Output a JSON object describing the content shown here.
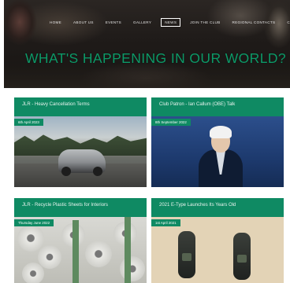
{
  "hero": {
    "title": "WHAT'S HAPPENING IN OUR WORLD?",
    "nav": [
      "HOME",
      "ABOUT US",
      "EVENTS",
      "GALLERY",
      "NEWS",
      "JOIN THE CLUB",
      "REGIONAL CONTACTS",
      "C"
    ],
    "active_nav": "NEWS"
  },
  "cards": [
    {
      "title": "JLR - Heavy Cancellation Terms",
      "date": "6th April 2023",
      "image": "car-on-mountain-road-photo"
    },
    {
      "title": "Club Patron - Ian Callum (OBE) Talk",
      "date": "8th September 2022",
      "image": "man-in-suit-portrait-photo"
    },
    {
      "title": "JLR - Recycle Plastic Sheets for Interiors",
      "date": "Thursday June 2022",
      "image": "recycling-rolls-photo"
    },
    {
      "title": "2021 E-Type Launches Its Years Old",
      "date": "1st April 2021",
      "image": "key-fobs-photo"
    }
  ],
  "colors": {
    "accent": "#0f8a63",
    "hero_title": "#0d9a68",
    "hero_bg": "#1f1b19"
  }
}
